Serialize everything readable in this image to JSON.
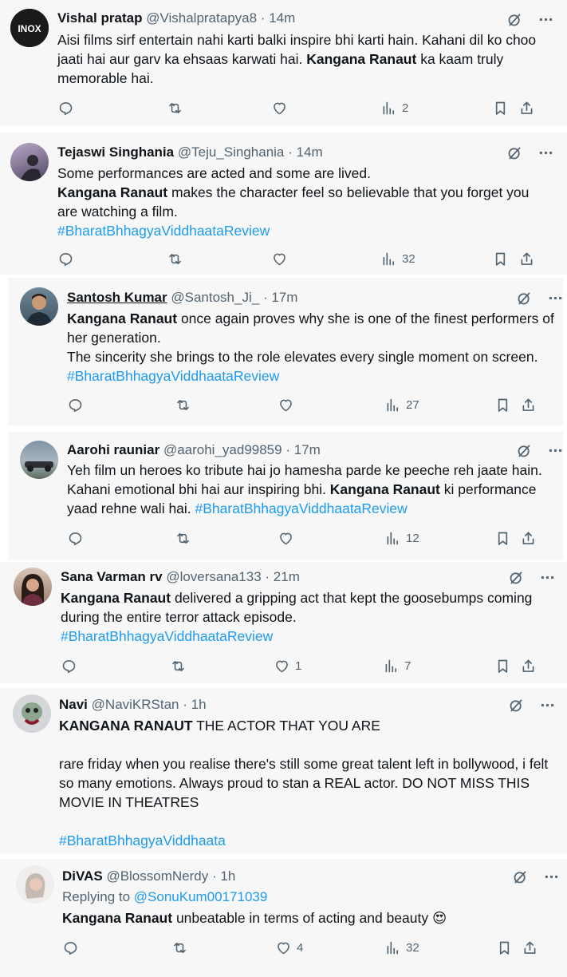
{
  "colors": {
    "tweet_bg": "#f7f7f7",
    "white_bg": "#ffffff",
    "link": "#1d9bf0",
    "muted": "#536471"
  },
  "tweets": [
    {
      "name": "Vishal pratap",
      "handle": "@Vishalpratapya8",
      "dot": "·",
      "time": "14m",
      "avatar_text": "INOX",
      "body": [
        [
          {
            "t": "Aisi films sirf entertain nahi karti balki inspire bhi karti hain. Kahani dil ko choo jaati hai aur garv ka ehsaas karwati hai. "
          },
          {
            "t": "Kangana Ranaut",
            "b": true
          },
          {
            "t": " ka kaam truly memorable hai."
          }
        ]
      ],
      "stats": {
        "reply": "",
        "retweet": "",
        "like": "",
        "views": "2"
      }
    },
    {
      "name": "Tejaswi Singhania",
      "handle": "@Teju_Singhania",
      "dot": "·",
      "time": "14m",
      "body": [
        [
          {
            "t": "Some performances are acted and some are lived."
          }
        ],
        [
          {
            "t": "Kangana Ranaut",
            "b": true
          },
          {
            "t": " makes the character feel so believable that you forget you are watching a film."
          }
        ],
        [
          {
            "t": "#BharatBhhagyaViddhaataReview",
            "link": true
          }
        ]
      ],
      "stats": {
        "reply": "",
        "retweet": "",
        "like": "",
        "views": "32"
      }
    },
    {
      "name": "Santosh Kumar",
      "handle": "@Santosh_Ji_",
      "dot": "·",
      "time": "17m",
      "body": [
        [
          {
            "t": "Kangana Ranaut",
            "b": true
          },
          {
            "t": " once again proves why she is one of the finest performers of her generation."
          }
        ],
        [
          {
            "t": "The sincerity she brings to the role elevates every single moment on screen."
          }
        ],
        [
          {
            "t": "#BharatBhhagyaViddhaataReview",
            "link": true
          }
        ]
      ],
      "stats": {
        "reply": "",
        "retweet": "",
        "like": "",
        "views": "27"
      }
    },
    {
      "name": "Aarohi rauniar",
      "handle": "@aarohi_yad99859",
      "dot": "·",
      "time": "17m",
      "body": [
        [
          {
            "t": "Yeh film un heroes ko tribute hai jo hamesha parde ke peeche reh jaate hain. Kahani emotional bhi hai aur inspiring bhi. "
          },
          {
            "t": "Kangana Ranaut",
            "b": true
          },
          {
            "t": " ki performance yaad rehne wali hai. "
          },
          {
            "t": "#BharatBhhagyaViddhaataReview",
            "link": true
          }
        ]
      ],
      "stats": {
        "reply": "",
        "retweet": "",
        "like": "",
        "views": "12"
      }
    },
    {
      "name": "Sana Varman rv",
      "handle": "@loversana133",
      "dot": "·",
      "time": "21m",
      "body": [
        [
          {
            "t": "Kangana Ranaut",
            "b": true
          },
          {
            "t": " delivered a gripping act that kept the goosebumps coming during the entire terror attack episode."
          }
        ],
        [
          {
            "t": "#BharatBhhagyaViddhaataReview",
            "link": true
          }
        ]
      ],
      "stats": {
        "reply": "",
        "retweet": "",
        "like": "1",
        "views": "7"
      }
    },
    {
      "name": "Navi",
      "handle": "@NaviKRStan",
      "dot": "·",
      "time": "1h",
      "body": [
        [
          {
            "t": "KANGANA RANAUT",
            "b": true
          },
          {
            "t": " THE ACTOR THAT YOU ARE"
          }
        ],
        [
          {
            "t": ""
          }
        ],
        [
          {
            "t": "rare friday when you realise there's still some great talent left in bollywood, i felt so many emotions. Always proud to stan a REAL actor. DO NOT MISS THIS MOVIE IN THEATRES"
          }
        ],
        [
          {
            "t": ""
          }
        ],
        [
          {
            "t": "#BharatBhhagyaViddhaata",
            "link": true
          }
        ]
      ],
      "stats": {
        "reply": "",
        "retweet": "",
        "like": "",
        "views": ""
      }
    },
    {
      "name": "DiVAS",
      "handle": "@BlossomNerdy",
      "dot": "·",
      "time": "1h",
      "replying_label": "Replying to ",
      "replying_to": "@SonuKum00171039",
      "body": [
        [
          {
            "t": "Kangana Ranaut",
            "b": true
          },
          {
            "t": " unbeatable in terms of acting and beauty 😍"
          }
        ]
      ],
      "stats": {
        "reply": "",
        "retweet": "",
        "like": "4",
        "views": "32"
      }
    }
  ],
  "icons": {
    "reply": "reply-icon",
    "retweet": "retweet-icon",
    "like": "heart-icon",
    "views": "views-icon",
    "bookmark": "bookmark-icon",
    "share": "share-icon",
    "grok": "grok-icon",
    "more": "more-icon"
  }
}
